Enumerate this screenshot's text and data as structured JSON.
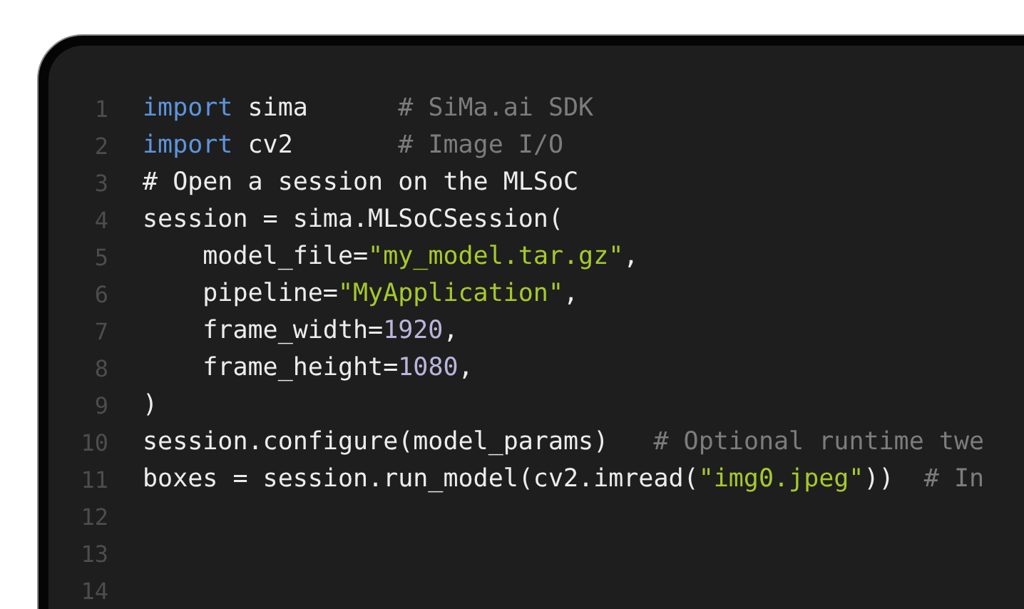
{
  "editor": {
    "lines": [
      {
        "number": "1",
        "tokens": [
          {
            "kind": "keyword",
            "text": "import"
          },
          {
            "kind": "plain",
            "text": " sima      "
          },
          {
            "kind": "comment",
            "text": "# SiMa.ai SDK"
          }
        ]
      },
      {
        "number": "2",
        "tokens": [
          {
            "kind": "keyword",
            "text": "import"
          },
          {
            "kind": "plain",
            "text": " cv2       "
          },
          {
            "kind": "comment",
            "text": "# Image I/O"
          }
        ]
      },
      {
        "number": "3",
        "tokens": [
          {
            "kind": "plain",
            "text": "# Open a session on the MLSoC"
          }
        ]
      },
      {
        "number": "4",
        "tokens": [
          {
            "kind": "plain",
            "text": "session = sima.MLSoCSession("
          }
        ]
      },
      {
        "number": "5",
        "tokens": [
          {
            "kind": "plain",
            "text": "    model_file="
          },
          {
            "kind": "string",
            "text": "\"my_model.tar.gz\""
          },
          {
            "kind": "plain",
            "text": ","
          }
        ]
      },
      {
        "number": "6",
        "tokens": [
          {
            "kind": "plain",
            "text": "    pipeline="
          },
          {
            "kind": "string",
            "text": "\"MyApplication\""
          },
          {
            "kind": "plain",
            "text": ","
          }
        ]
      },
      {
        "number": "7",
        "tokens": [
          {
            "kind": "plain",
            "text": "    frame_width="
          },
          {
            "kind": "number",
            "text": "1920"
          },
          {
            "kind": "plain",
            "text": ","
          }
        ]
      },
      {
        "number": "8",
        "tokens": [
          {
            "kind": "plain",
            "text": "    frame_height="
          },
          {
            "kind": "number",
            "text": "1080"
          },
          {
            "kind": "plain",
            "text": ","
          }
        ]
      },
      {
        "number": "9",
        "tokens": [
          {
            "kind": "plain",
            "text": ")"
          }
        ]
      },
      {
        "number": "10",
        "tokens": [
          {
            "kind": "plain",
            "text": "session.configure(model_params)   "
          },
          {
            "kind": "comment",
            "text": "# Optional runtime twe"
          }
        ]
      },
      {
        "number": "11",
        "tokens": [
          {
            "kind": "plain",
            "text": "boxes = session.run_model(cv2.imread("
          },
          {
            "kind": "string",
            "text": "\"img0.jpeg\""
          },
          {
            "kind": "plain",
            "text": "))  "
          },
          {
            "kind": "comment",
            "text": "# In"
          }
        ]
      },
      {
        "number": "12"
      },
      {
        "number": "13"
      },
      {
        "number": "14"
      }
    ]
  }
}
